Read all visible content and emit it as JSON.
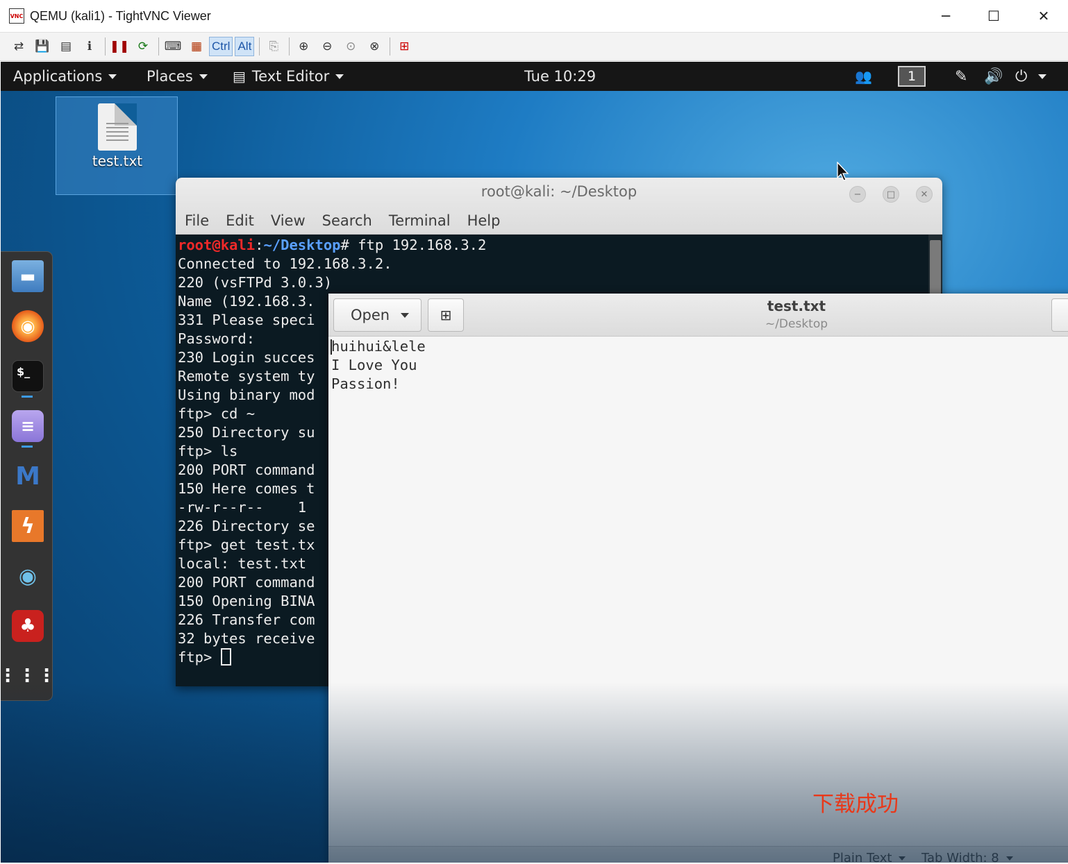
{
  "host_window": {
    "title": "QEMU (kali1) - TightVNC Viewer",
    "logo_text": "VNC",
    "minimize_glyph": "─",
    "maximize_glyph": "☐",
    "close_glyph": "✕"
  },
  "vnc_toolbar": {
    "ctrl_label": "Ctrl",
    "alt_label": "Alt"
  },
  "gnome_topbar": {
    "applications": "Applications",
    "places": "Places",
    "text_editor": "Text Editor",
    "clock": "Tue 10:29",
    "workspace": "1"
  },
  "desktop": {
    "icons": [
      {
        "label": "test.txt"
      }
    ]
  },
  "terminal": {
    "title": "root@kali: ~/Desktop",
    "menu": [
      "File",
      "Edit",
      "View",
      "Search",
      "Terminal",
      "Help"
    ],
    "prompt_user": "root@kali",
    "prompt_sep": ":",
    "prompt_path": "~/Desktop",
    "first_command": "# ftp 192.168.3.2",
    "lines": [
      "Connected to 192.168.3.2.",
      "220 (vsFTPd 3.0.3)",
      "Name (192.168.3.",
      "331 Please speci",
      "Password:",
      "230 Login succes",
      "Remote system ty",
      "Using binary mod",
      "ftp> cd ~",
      "250 Directory su",
      "ftp> ls",
      "200 PORT command",
      "150 Here comes t",
      "-rw-r--r--    1",
      "226 Directory se",
      "ftp> get test.tx",
      "local: test.txt",
      "200 PORT command",
      "150 Opening BINA",
      "226 Transfer com",
      "32 bytes receive"
    ],
    "last_prompt": "ftp> "
  },
  "editor": {
    "open_label": "Open",
    "title": "test.txt",
    "subtitle": "~/Desktop",
    "content_lines": [
      "huihui&lele",
      "I Love You",
      "Passion!"
    ],
    "status_syntax": "Plain Text",
    "status_tab_width": "Tab Width: 8"
  },
  "annotation": "下载成功",
  "colors": {
    "prompt_user": "#ef2929",
    "prompt_path": "#5aa0ff",
    "annotation": "#e8381a"
  }
}
